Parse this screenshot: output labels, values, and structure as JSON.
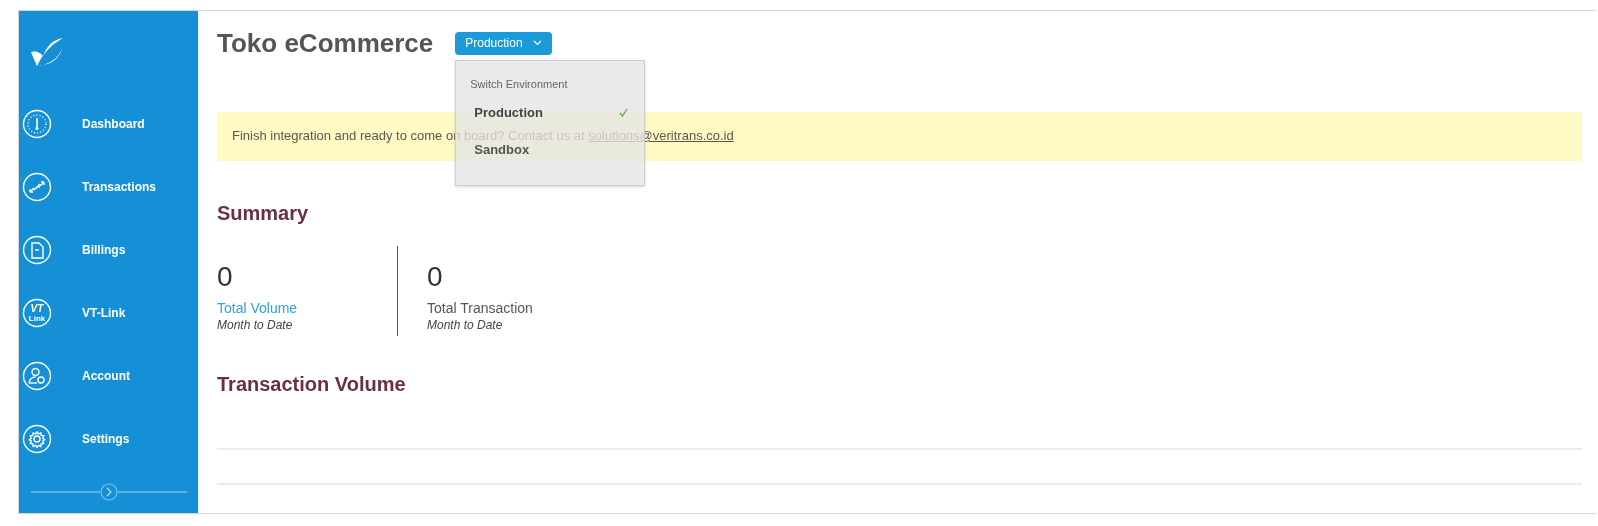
{
  "sidebar": {
    "items": [
      {
        "label": "Dashboard",
        "kind": "gauge"
      },
      {
        "label": "Transactions",
        "kind": "transfer"
      },
      {
        "label": "Billings",
        "kind": "document"
      },
      {
        "label": "VT-Link",
        "kind": "vtlink",
        "icon_text": [
          "VT",
          "Link"
        ]
      },
      {
        "label": "Account",
        "kind": "account"
      },
      {
        "label": "Settings",
        "kind": "gear"
      }
    ]
  },
  "header": {
    "title": "Toko eCommerce",
    "environment_button": "Production"
  },
  "environment_menu": {
    "heading": "Switch Environment",
    "options": [
      {
        "label": "Production",
        "selected": true
      },
      {
        "label": "Sandbox",
        "selected": false
      }
    ]
  },
  "banner": {
    "text": "Finish integration and ready to come on board? Contact us at ",
    "link": "solutions@veritrans.co.id"
  },
  "summary": {
    "title": "Summary",
    "stats": [
      {
        "value": "0",
        "label": "Total Volume",
        "sublabel": "Month to Date",
        "kind": "link"
      },
      {
        "value": "0",
        "label": "Total Transaction",
        "sublabel": "Month to Date",
        "kind": "plain"
      }
    ]
  },
  "transaction_volume": {
    "title": "Transaction Volume"
  }
}
